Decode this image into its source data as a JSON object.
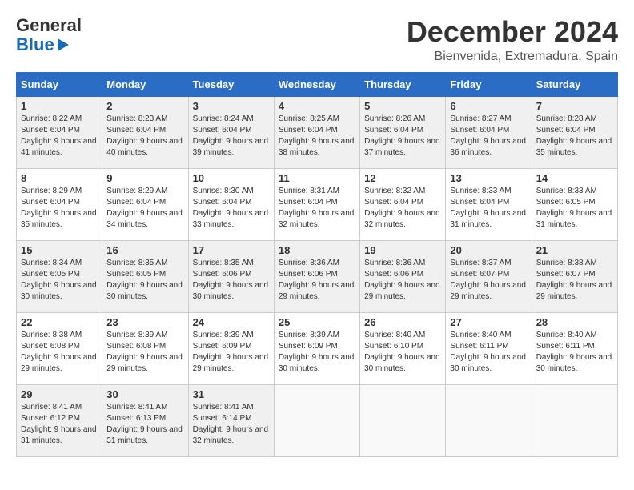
{
  "logo": {
    "general": "General",
    "blue": "Blue"
  },
  "title": "December 2024",
  "location": "Bienvenida, Extremadura, Spain",
  "days_header": [
    "Sunday",
    "Monday",
    "Tuesday",
    "Wednesday",
    "Thursday",
    "Friday",
    "Saturday"
  ],
  "weeks": [
    [
      {
        "day": "1",
        "sunrise": "8:22 AM",
        "sunset": "6:04 PM",
        "daylight": "9 hours and 41 minutes."
      },
      {
        "day": "2",
        "sunrise": "8:23 AM",
        "sunset": "6:04 PM",
        "daylight": "9 hours and 40 minutes."
      },
      {
        "day": "3",
        "sunrise": "8:24 AM",
        "sunset": "6:04 PM",
        "daylight": "9 hours and 39 minutes."
      },
      {
        "day": "4",
        "sunrise": "8:25 AM",
        "sunset": "6:04 PM",
        "daylight": "9 hours and 38 minutes."
      },
      {
        "day": "5",
        "sunrise": "8:26 AM",
        "sunset": "6:04 PM",
        "daylight": "9 hours and 37 minutes."
      },
      {
        "day": "6",
        "sunrise": "8:27 AM",
        "sunset": "6:04 PM",
        "daylight": "9 hours and 36 minutes."
      },
      {
        "day": "7",
        "sunrise": "8:28 AM",
        "sunset": "6:04 PM",
        "daylight": "9 hours and 35 minutes."
      }
    ],
    [
      {
        "day": "8",
        "sunrise": "8:29 AM",
        "sunset": "6:04 PM",
        "daylight": "9 hours and 35 minutes."
      },
      {
        "day": "9",
        "sunrise": "8:29 AM",
        "sunset": "6:04 PM",
        "daylight": "9 hours and 34 minutes."
      },
      {
        "day": "10",
        "sunrise": "8:30 AM",
        "sunset": "6:04 PM",
        "daylight": "9 hours and 33 minutes."
      },
      {
        "day": "11",
        "sunrise": "8:31 AM",
        "sunset": "6:04 PM",
        "daylight": "9 hours and 32 minutes."
      },
      {
        "day": "12",
        "sunrise": "8:32 AM",
        "sunset": "6:04 PM",
        "daylight": "9 hours and 32 minutes."
      },
      {
        "day": "13",
        "sunrise": "8:33 AM",
        "sunset": "6:04 PM",
        "daylight": "9 hours and 31 minutes."
      },
      {
        "day": "14",
        "sunrise": "8:33 AM",
        "sunset": "6:05 PM",
        "daylight": "9 hours and 31 minutes."
      }
    ],
    [
      {
        "day": "15",
        "sunrise": "8:34 AM",
        "sunset": "6:05 PM",
        "daylight": "9 hours and 30 minutes."
      },
      {
        "day": "16",
        "sunrise": "8:35 AM",
        "sunset": "6:05 PM",
        "daylight": "9 hours and 30 minutes."
      },
      {
        "day": "17",
        "sunrise": "8:35 AM",
        "sunset": "6:06 PM",
        "daylight": "9 hours and 30 minutes."
      },
      {
        "day": "18",
        "sunrise": "8:36 AM",
        "sunset": "6:06 PM",
        "daylight": "9 hours and 29 minutes."
      },
      {
        "day": "19",
        "sunrise": "8:36 AM",
        "sunset": "6:06 PM",
        "daylight": "9 hours and 29 minutes."
      },
      {
        "day": "20",
        "sunrise": "8:37 AM",
        "sunset": "6:07 PM",
        "daylight": "9 hours and 29 minutes."
      },
      {
        "day": "21",
        "sunrise": "8:38 AM",
        "sunset": "6:07 PM",
        "daylight": "9 hours and 29 minutes."
      }
    ],
    [
      {
        "day": "22",
        "sunrise": "8:38 AM",
        "sunset": "6:08 PM",
        "daylight": "9 hours and 29 minutes."
      },
      {
        "day": "23",
        "sunrise": "8:39 AM",
        "sunset": "6:08 PM",
        "daylight": "9 hours and 29 minutes."
      },
      {
        "day": "24",
        "sunrise": "8:39 AM",
        "sunset": "6:09 PM",
        "daylight": "9 hours and 29 minutes."
      },
      {
        "day": "25",
        "sunrise": "8:39 AM",
        "sunset": "6:09 PM",
        "daylight": "9 hours and 30 minutes."
      },
      {
        "day": "26",
        "sunrise": "8:40 AM",
        "sunset": "6:10 PM",
        "daylight": "9 hours and 30 minutes."
      },
      {
        "day": "27",
        "sunrise": "8:40 AM",
        "sunset": "6:11 PM",
        "daylight": "9 hours and 30 minutes."
      },
      {
        "day": "28",
        "sunrise": "8:40 AM",
        "sunset": "6:11 PM",
        "daylight": "9 hours and 30 minutes."
      }
    ],
    [
      {
        "day": "29",
        "sunrise": "8:41 AM",
        "sunset": "6:12 PM",
        "daylight": "9 hours and 31 minutes."
      },
      {
        "day": "30",
        "sunrise": "8:41 AM",
        "sunset": "6:13 PM",
        "daylight": "9 hours and 31 minutes."
      },
      {
        "day": "31",
        "sunrise": "8:41 AM",
        "sunset": "6:14 PM",
        "daylight": "9 hours and 32 minutes."
      },
      null,
      null,
      null,
      null
    ]
  ]
}
